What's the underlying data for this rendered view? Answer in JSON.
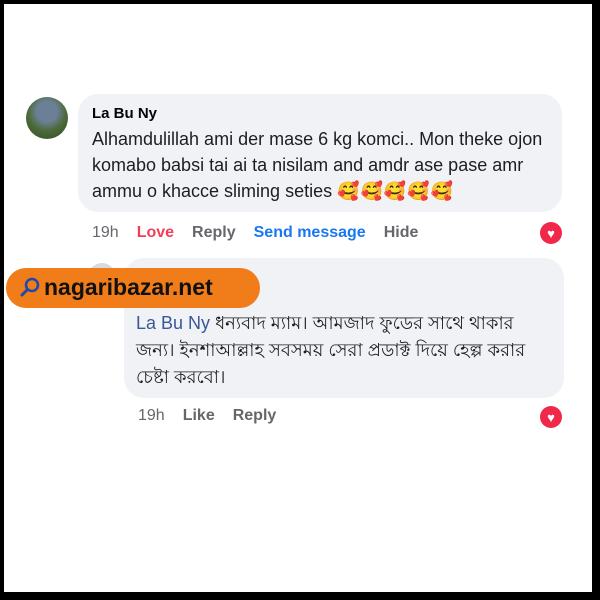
{
  "comment": {
    "author": "La Bu Ny",
    "text": "Alhamdulillah ami der mase 6 kg komci.. Mon theke ojon komabo babsi tai ai ta nisilam and amdr ase pase amr ammu o khacce sliming seties",
    "emojis": "🥰🥰🥰🥰🥰",
    "time": "19h",
    "love_label": "Love",
    "reply_label": "Reply",
    "send_message_label": "Send message",
    "hide_label": "Hide"
  },
  "reply": {
    "mention": "La Bu Ny",
    "text": "ধন্যবাদ ম্যাম। আমজাদ ফুডের সাথে থাকার জন্য। ইনশাআল্লাহ সবসময় সেরা প্রডাক্ট দিয়ে হেল্প করার চেষ্টা করবো।",
    "time": "19h",
    "like_label": "Like",
    "reply_label": "Reply"
  },
  "brand": {
    "site": "nagaribazar.net"
  },
  "colors": {
    "love": "#f33e58",
    "link": "#1877f2",
    "brand_bg": "#f07c1a",
    "bubble": "#f0f2f5"
  },
  "icons": {
    "reaction": "heart-icon",
    "brand": "magnifier-icon"
  }
}
